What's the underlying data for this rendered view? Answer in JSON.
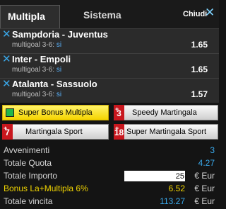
{
  "tabs": {
    "multipla": "Multipla",
    "sistema": "Sistema",
    "chiudi": "Chiudi",
    "close_glyph": "✕"
  },
  "bets": [
    {
      "teams": "Sampdoria - Juventus",
      "market": "multigoal 3-6:",
      "pick": "si",
      "odd": "1.65"
    },
    {
      "teams": "Inter - Empoli",
      "market": "multigoal 3-6:",
      "pick": "si",
      "odd": "1.65"
    },
    {
      "teams": "Atalanta - Sassuolo",
      "market": "multigoal 3-6:",
      "pick": "si",
      "odd": "1.57"
    }
  ],
  "remove_glyph": "✕",
  "bonus_buttons": {
    "super_bonus": "Super Bonus Multipla",
    "speedy": "Speedy Martingala",
    "speedy_badge": "3",
    "martingala_sport": "Martingala Sport",
    "martingala_badge": "7",
    "super_martingala": "Super Martingala Sport",
    "super_badge": "18",
    "badge_plus": "+"
  },
  "summary": {
    "avvenimenti_label": "Avvenimenti",
    "avvenimenti_value": "3",
    "quota_label": "Totale Quota",
    "quota_value": "4.27",
    "importo_label": "Totale Importo",
    "importo_value": "25",
    "currency": "€ Eur",
    "bonus_label": "Bonus La+Multipla 6%",
    "bonus_value": "6.52",
    "vincita_label": "Totale vincita",
    "vincita_value": "113.27"
  },
  "colors": {
    "accent_blue": "#3aa7e8",
    "bonus_yellow": "#f0d400",
    "badge_red": "#c8171e",
    "check_green": "#23b84a"
  }
}
